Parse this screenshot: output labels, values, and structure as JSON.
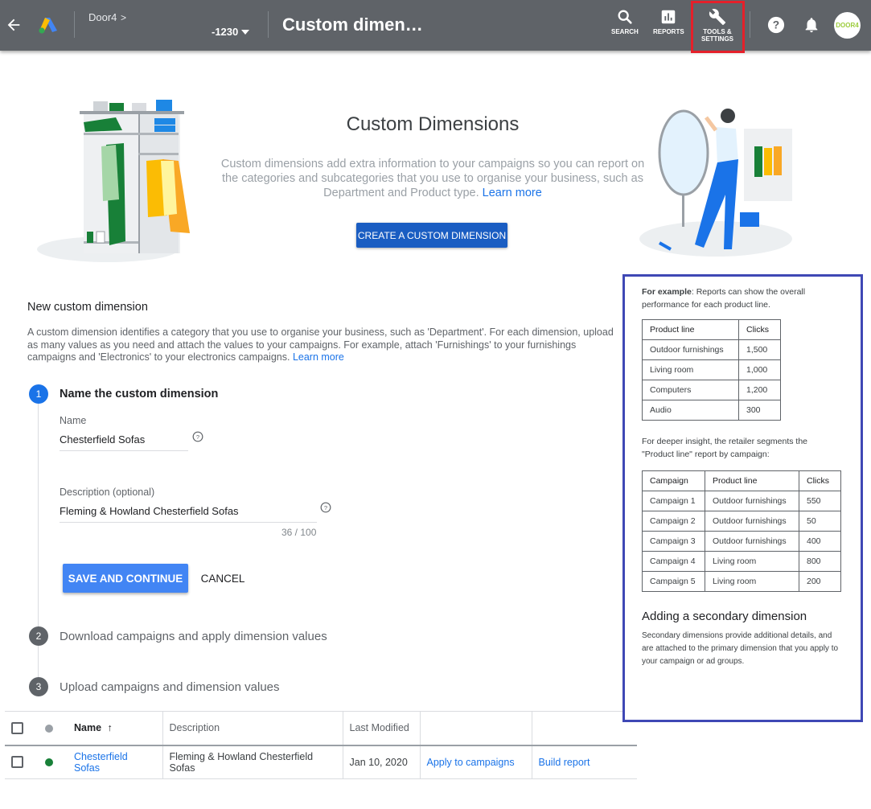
{
  "topbar": {
    "account_name": "Door4",
    "account_chevron": ">",
    "account_id": "-1230",
    "page_title": "Custom dimen…",
    "search_label": "SEARCH",
    "reports_label": "REPORTS",
    "tools_label_1": "TOOLS &",
    "tools_label_2": "SETTINGS",
    "avatar_text": "DOOR4",
    "tools_highlight_color": "#e5202a"
  },
  "hero": {
    "title": "Custom Dimensions",
    "description": "Custom dimensions add extra information to your campaigns so you can report on the categories and subcategories that you use to organise your business, such as Department and Product type.",
    "learn_more": "Learn more",
    "create_button": "CREATE A CUSTOM DIMENSION"
  },
  "new_dimension": {
    "title": "New custom dimension",
    "description": "A custom dimension identifies a category that you use to organise your business, such as 'Department'. For each dimension, upload as many values as you need and attach the values to your campaigns. For example, attach 'Furnishings' to your furnishings campaigns and 'Electronics' to your electronics campaigns.",
    "learn_more": "Learn more",
    "steps": [
      {
        "number": "1",
        "label": "Name the custom dimension"
      },
      {
        "number": "2",
        "label": "Download campaigns and apply dimension values"
      },
      {
        "number": "3",
        "label": "Upload campaigns and dimension values"
      }
    ],
    "name_label": "Name",
    "name_value": "Chesterfield Sofas",
    "description_label": "Description (optional)",
    "description_value": "Fleming & Howland Chesterfield Sofas",
    "counter": "36 / 100",
    "save_button": "SAVE AND CONTINUE",
    "cancel_button": "CANCEL"
  },
  "table": {
    "headers": {
      "name": "Name",
      "sort_arrow": "↑",
      "description": "Description",
      "last_modified": "Last Modified"
    },
    "rows": [
      {
        "name": "Chesterfield Sofas",
        "description": "Fleming & Howland Chesterfield Sofas",
        "last_modified": "Jan 10, 2020",
        "apply": "Apply to campaigns",
        "build": "Build report",
        "status_color": "#188038"
      }
    ]
  },
  "example": {
    "intro_bold": "For example",
    "intro_rest": ": Reports can show the overall performance for each product line.",
    "table1": {
      "headers": [
        "Product line",
        "Clicks"
      ],
      "rows": [
        [
          "Outdoor furnishings",
          "1,500"
        ],
        [
          "Living room",
          "1,000"
        ],
        [
          "Computers",
          "1,200"
        ],
        [
          "Audio",
          "300"
        ]
      ]
    },
    "deeper": "For deeper insight, the retailer segments the \"Product line\" report by campaign:",
    "table2": {
      "headers": [
        "Campaign",
        "Product line",
        "Clicks"
      ],
      "rows": [
        [
          "Campaign 1",
          "Outdoor furnishings",
          "550"
        ],
        [
          "Campaign 2",
          "Outdoor furnishings",
          "50"
        ],
        [
          "Campaign 3",
          "Outdoor furnishings",
          "400"
        ],
        [
          "Campaign 4",
          "Living room",
          "800"
        ],
        [
          "Campaign 5",
          "Living room",
          "200"
        ]
      ]
    },
    "secondary_title": "Adding a secondary dimension",
    "secondary_text": "Secondary dimensions provide additional details, and are attached to the primary dimension that you apply to your campaign or ad groups.",
    "border_color": "#3f48b5"
  }
}
